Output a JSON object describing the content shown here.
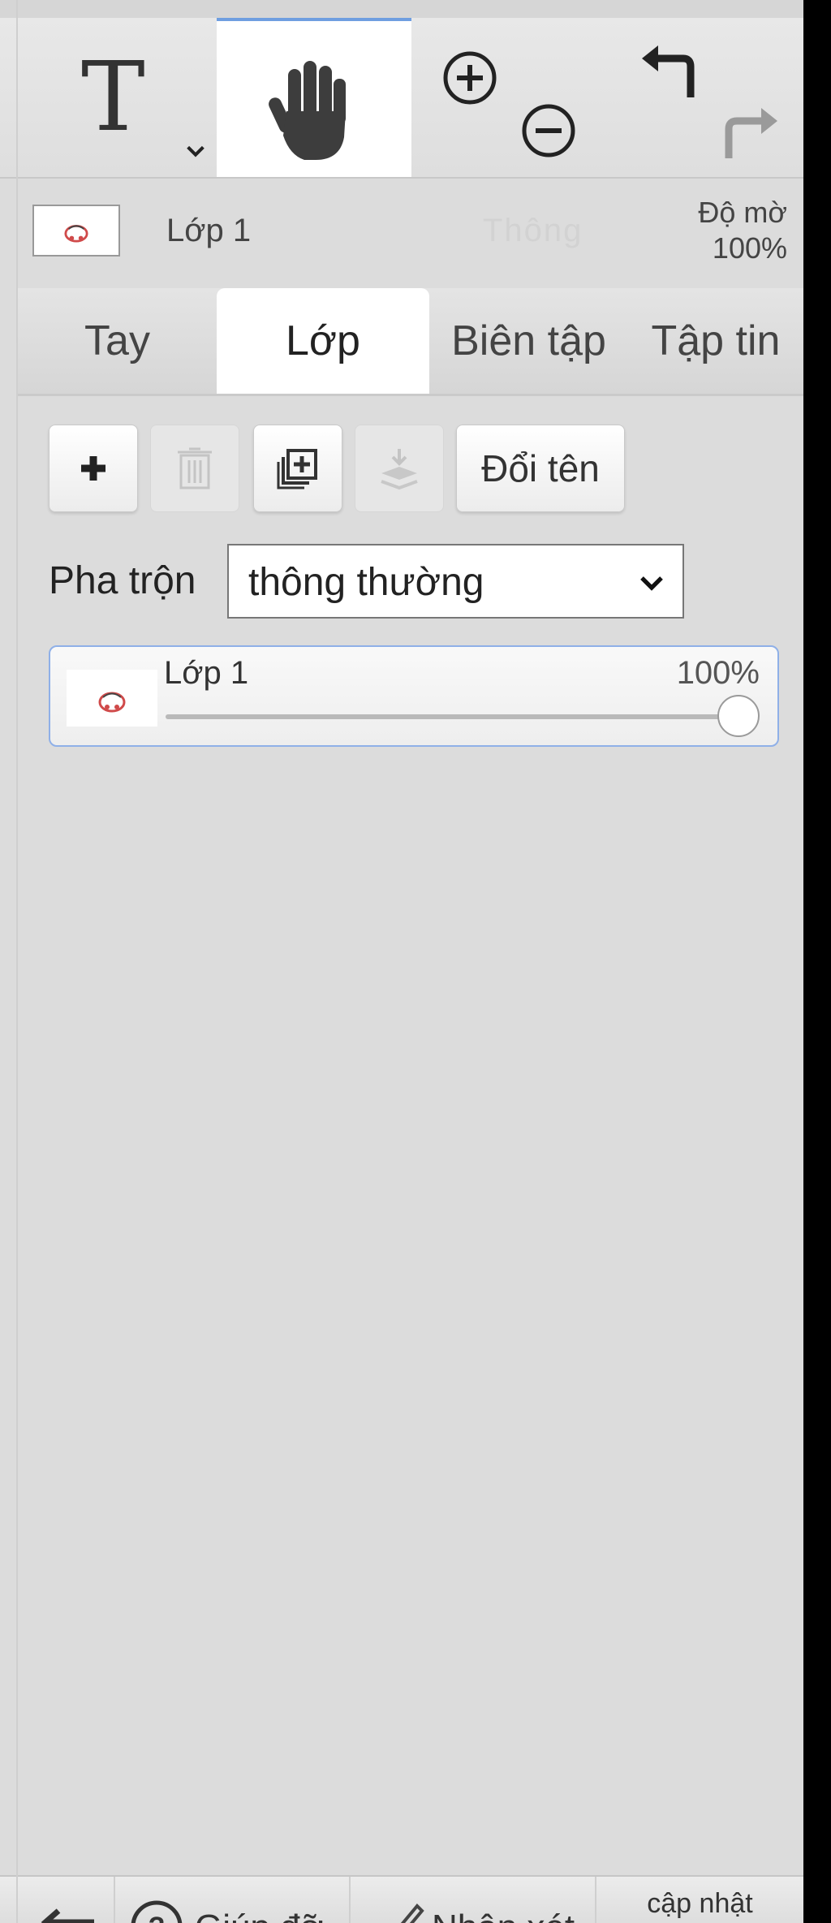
{
  "toolbar": {
    "tools": [
      {
        "name": "text-tool",
        "icon": "text-icon",
        "glyph": "T"
      },
      {
        "name": "hand-tool",
        "icon": "hand-icon",
        "active": true
      },
      {
        "name": "zoom-tool",
        "icons": [
          "zoom-in-icon",
          "zoom-out-icon"
        ]
      },
      {
        "name": "history-tool",
        "icons": [
          "undo-icon",
          "redo-icon"
        ]
      }
    ],
    "accent": "#6f9ee0"
  },
  "layer_strip": {
    "layer_name": "Lớp 1",
    "faded_text": "Thông",
    "opacity_title": "Độ mờ",
    "opacity_value": "100%"
  },
  "tabs": [
    {
      "label": "Tay"
    },
    {
      "label": "Lớp",
      "active": true
    },
    {
      "label": "Biên tập"
    },
    {
      "label": "Tập tin"
    }
  ],
  "layer_buttons": {
    "add_icon": "plus-icon",
    "delete_icon": "trash-icon",
    "duplicate_icon": "duplicate-icon",
    "merge_icon": "merge-down-icon",
    "rename_label": "Đổi tên"
  },
  "blend": {
    "label": "Pha trộn",
    "value": "thông thường"
  },
  "layers": [
    {
      "name": "Lớp 1",
      "opacity": "100%",
      "opacity_fraction": 1.0
    }
  ],
  "bottom_bar": {
    "back_icon": "back-arrow-icon",
    "help_icon": "help-icon",
    "help_label": "Giúp đỡ",
    "feedback_icon": "pencil-icon",
    "feedback_label": "Nhận xét",
    "update_label": "cập nhật"
  }
}
